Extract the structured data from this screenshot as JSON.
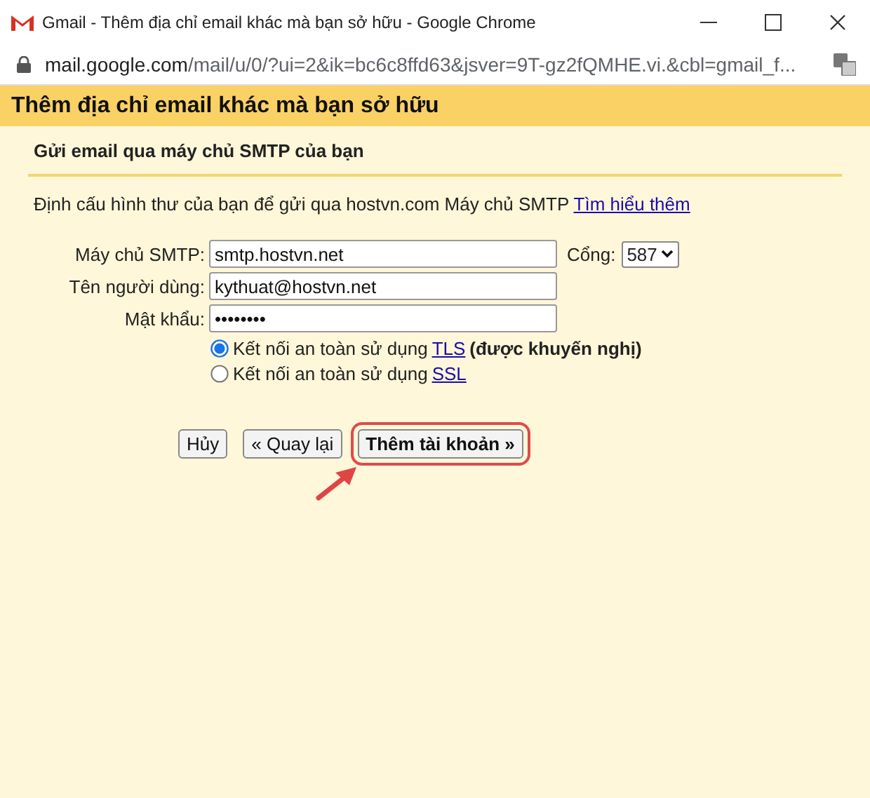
{
  "window": {
    "title": "Gmail - Thêm địa chỉ email khác mà bạn sở hữu - Google Chrome",
    "address": {
      "host": "mail.google.com",
      "path": "/mail/u/0/?ui=2&ik=bc6c8ffd63&jsver=9T-gz2fQMHE.vi.&cbl=gmail_f..."
    }
  },
  "dialog": {
    "title": "Thêm địa chỉ email khác mà bạn sở hữu",
    "subtitle": "Gửi email qua máy chủ SMTP của bạn",
    "intro": "Định cấu hình thư của bạn để gửi qua hostvn.com Máy chủ SMTP",
    "intro_link": "Tìm hiểu thêm",
    "fields": [
      {
        "label": "Máy chủ SMTP:",
        "value": "smtp.hostvn.net"
      },
      {
        "label": "Tên người dùng:",
        "value": "kythuat@hostvn.net"
      },
      {
        "label": "Mật khẩu:",
        "value": "••••••••"
      }
    ],
    "port": {
      "label": "Cổng:",
      "value": "587"
    },
    "security": [
      {
        "label": "Kết nối an toàn sử dụng",
        "link": "TLS",
        "note": "(được khuyến nghị)",
        "selected": true
      },
      {
        "label": "Kết nối an toàn sử dụng",
        "link": "SSL",
        "selected": false
      }
    ],
    "buttons": [
      {
        "label": "Hủy",
        "highlighted": false
      },
      {
        "label": "« Quay lại",
        "highlighted": false
      },
      {
        "label": "Thêm tài khoản »",
        "highlighted": true
      }
    ]
  }
}
